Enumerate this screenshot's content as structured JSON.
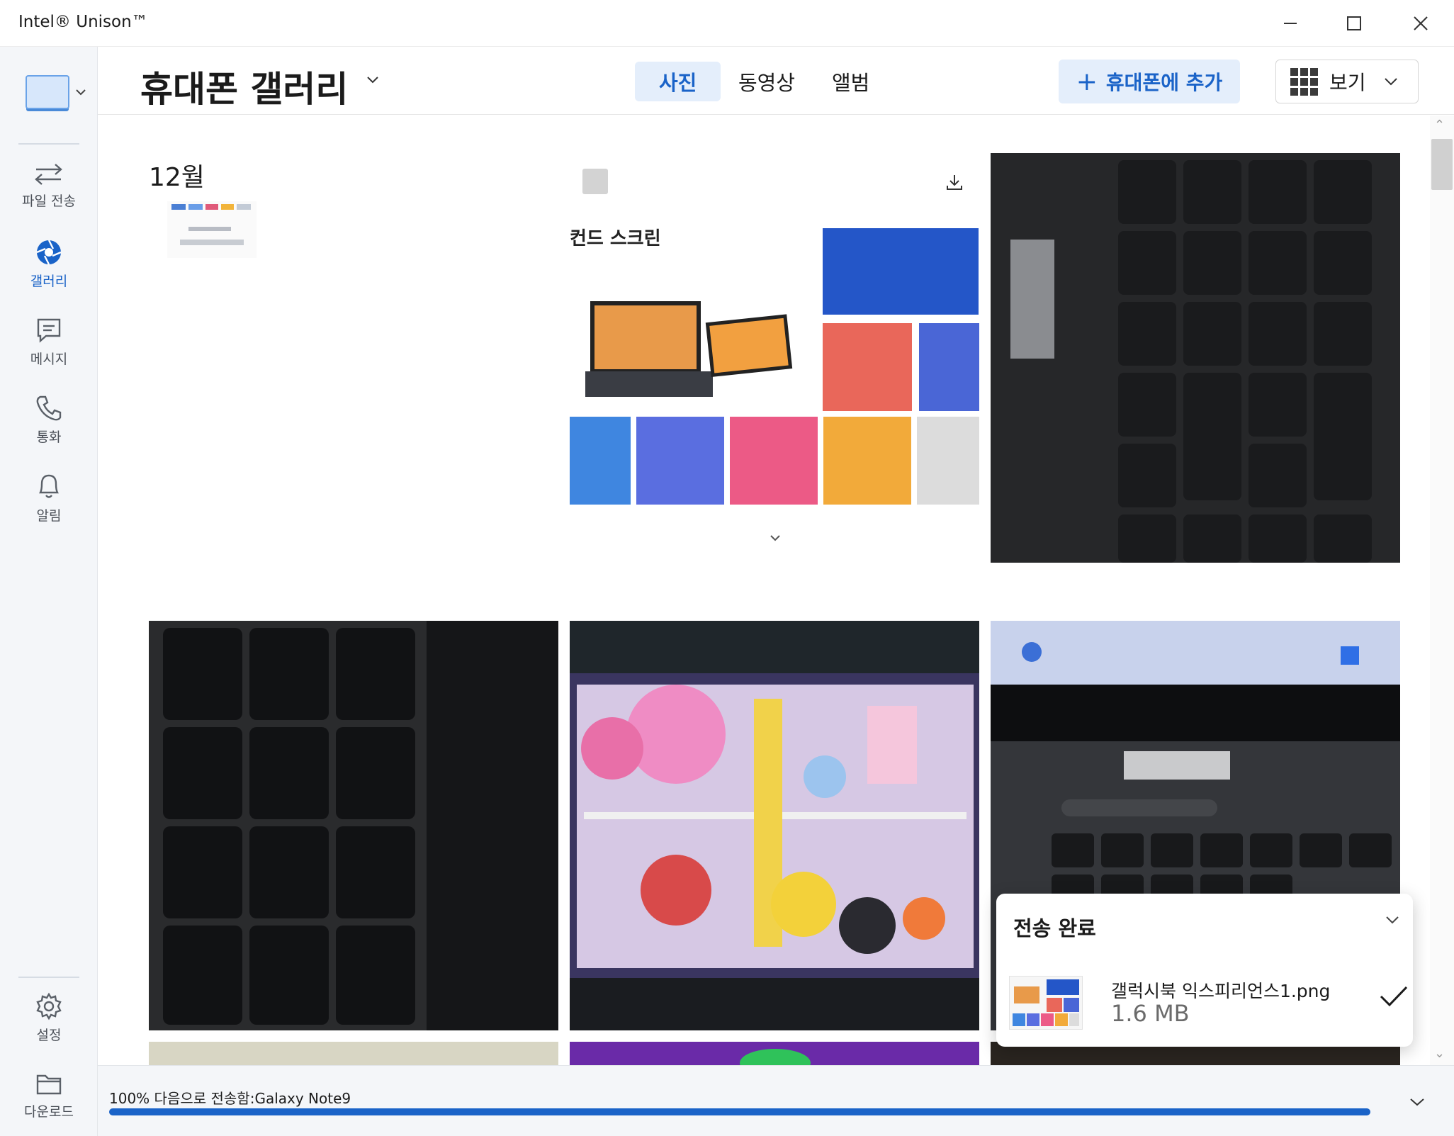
{
  "window": {
    "title": "Intel® Unison™"
  },
  "sidebar": {
    "items": [
      {
        "label": "파일 전송",
        "icon": "transfer-icon"
      },
      {
        "label": "갤러리",
        "icon": "gallery-icon",
        "active": true
      },
      {
        "label": "메시지",
        "icon": "message-icon"
      },
      {
        "label": "통화",
        "icon": "phone-icon"
      },
      {
        "label": "알림",
        "icon": "bell-icon"
      }
    ],
    "bottom_items": [
      {
        "label": "설정",
        "icon": "gear-icon"
      },
      {
        "label": "다운로드",
        "icon": "folder-icon"
      }
    ]
  },
  "header": {
    "title": "휴대폰 갤러리",
    "tabs": [
      {
        "label": "사진",
        "active": true
      },
      {
        "label": "동영상"
      },
      {
        "label": "앨범"
      }
    ],
    "add_button": "휴대폰에 추가",
    "view_button": "보기"
  },
  "gallery": {
    "month": "12월",
    "promo_caption": "컨드 스크린"
  },
  "toast": {
    "title": "전송 완료",
    "file_name": "갤럭시북 익스피리언스1.png",
    "file_size": "1.6 MB"
  },
  "transfer": {
    "percent_text": "100%",
    "status_text": "다음으로 전송함:Galaxy Note9",
    "progress": 1.0
  },
  "colors": {
    "accent": "#1a63c8",
    "accent_bg": "#e4eefb",
    "sidebar_bg": "#f4f6f9"
  }
}
